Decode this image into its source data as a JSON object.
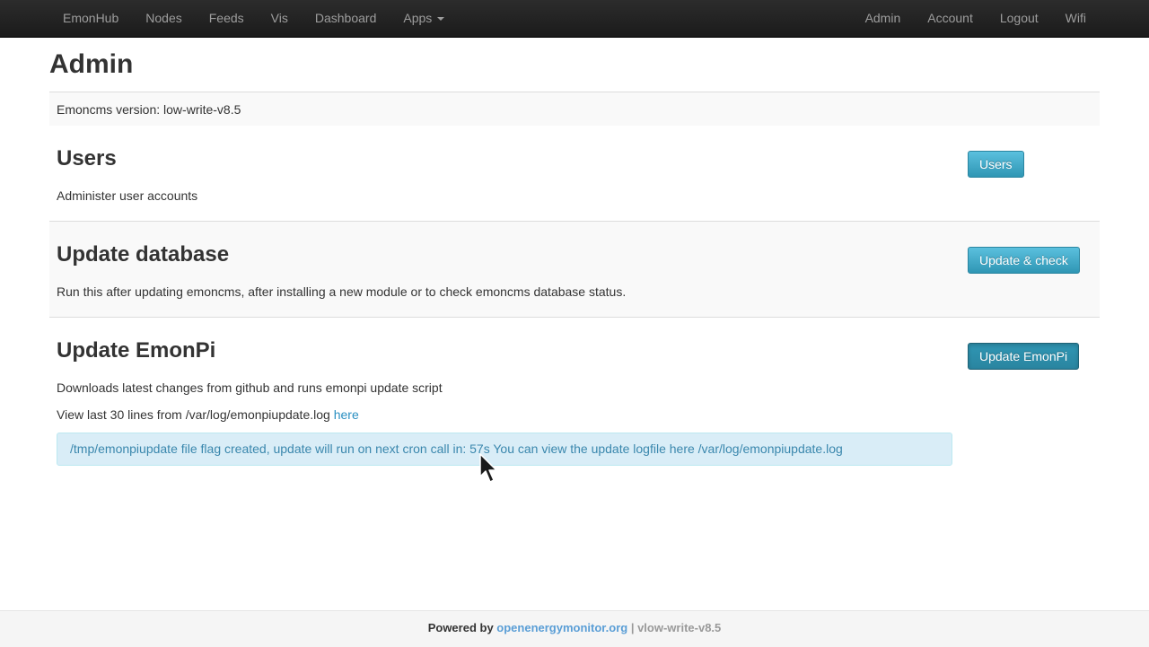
{
  "navbar": {
    "left": [
      "EmonHub",
      "Nodes",
      "Feeds",
      "Vis",
      "Dashboard",
      "Apps"
    ],
    "right": [
      "Admin",
      "Account",
      "Logout",
      "Wifi"
    ]
  },
  "page": {
    "title": "Admin"
  },
  "version": {
    "text": "Emoncms version: low-write-v8.5"
  },
  "users": {
    "title": "Users",
    "description": "Administer user accounts",
    "button": "Users"
  },
  "database": {
    "title": "Update database",
    "description": "Run this after updating emoncms, after installing a new module or to check emoncms database status.",
    "button": "Update & check"
  },
  "emonpi": {
    "title": "Update EmonPi",
    "description": "Downloads latest changes from github and runs emonpi update script",
    "log_prefix": "View last 30 lines from /var/log/emonpiupdate.log",
    "log_link": "here",
    "button": "Update EmonPi",
    "alert": "/tmp/emonpiupdate file flag created, update will run on next cron call in: 57s You can view the update logfile here /var/log/emonpiupdate.log"
  },
  "footer": {
    "powered_by": "Powered by",
    "link": "openenergymonitor.org",
    "version": "| vlow-write-v8.5"
  },
  "colors": {
    "navbar": "#1b1b1b",
    "button": "#49afcd",
    "alert_bg": "#d9edf7",
    "alert_text": "#3a87ad",
    "link": "#2a8fc1"
  }
}
